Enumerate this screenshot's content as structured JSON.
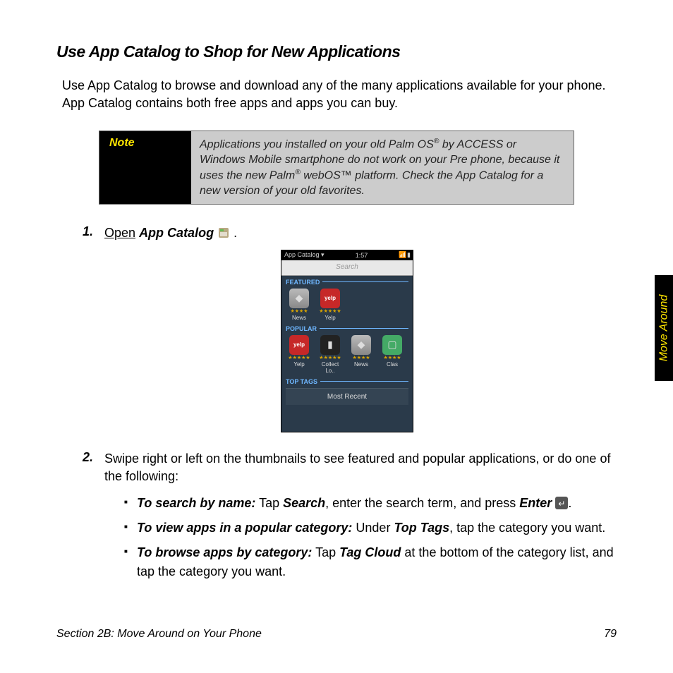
{
  "heading": "Use App Catalog to Shop for New Applications",
  "intro": "Use App Catalog to browse and download any of the many applications available for your phone. App Catalog contains both free apps and apps you can buy.",
  "note": {
    "label": "Note",
    "body_html": "Applications you installed on your old Palm OS<sup>®</sup> by ACCESS or Windows Mobile smartphone do not work on your Pre phone, because it uses the new Palm<sup>®</sup> webOS™ platform. Check the App Catalog for a new version of your old favorites."
  },
  "steps": {
    "s1": {
      "num": "1.",
      "open": "Open",
      "app": "App Catalog",
      "period": " ."
    },
    "s2": {
      "num": "2.",
      "text": "Swipe right or left on the thumbnails to see featured and popular applications, or do one of the following:"
    }
  },
  "bullets": {
    "b1": {
      "lead": "To search by name:",
      "t1": " Tap ",
      "k1": "Search",
      "t2": ", enter the search term, and press ",
      "k2": "Enter",
      "t3": " ",
      "t4": "."
    },
    "b2": {
      "lead": "To view apps in a popular category:",
      "t1": " Under ",
      "k1": "Top Tags",
      "t2": ", tap the category you want."
    },
    "b3": {
      "lead": "To browse apps by category:",
      "t1": " Tap ",
      "k1": "Tag Cloud",
      "t2": " at the bottom of the category list, and tap the category you want."
    }
  },
  "phone": {
    "title": "App Catalog",
    "time": "1:57",
    "search": "Search",
    "sec_featured": "FEATURED",
    "sec_popular": "POPULAR",
    "sec_toptags": "TOP TAGS",
    "tag_mostrecent": "Most Recent",
    "apps": {
      "f1": "News",
      "f2": "Yelp",
      "p1": "Yelp",
      "p2": "Collect Lo..",
      "p3": "News",
      "p4": "Clas"
    },
    "stars4": "★★★★",
    "stars5": "★★★★★"
  },
  "sidetab": "Move Around",
  "footer": {
    "section": "Section 2B: Move Around on Your Phone",
    "page": "79"
  }
}
